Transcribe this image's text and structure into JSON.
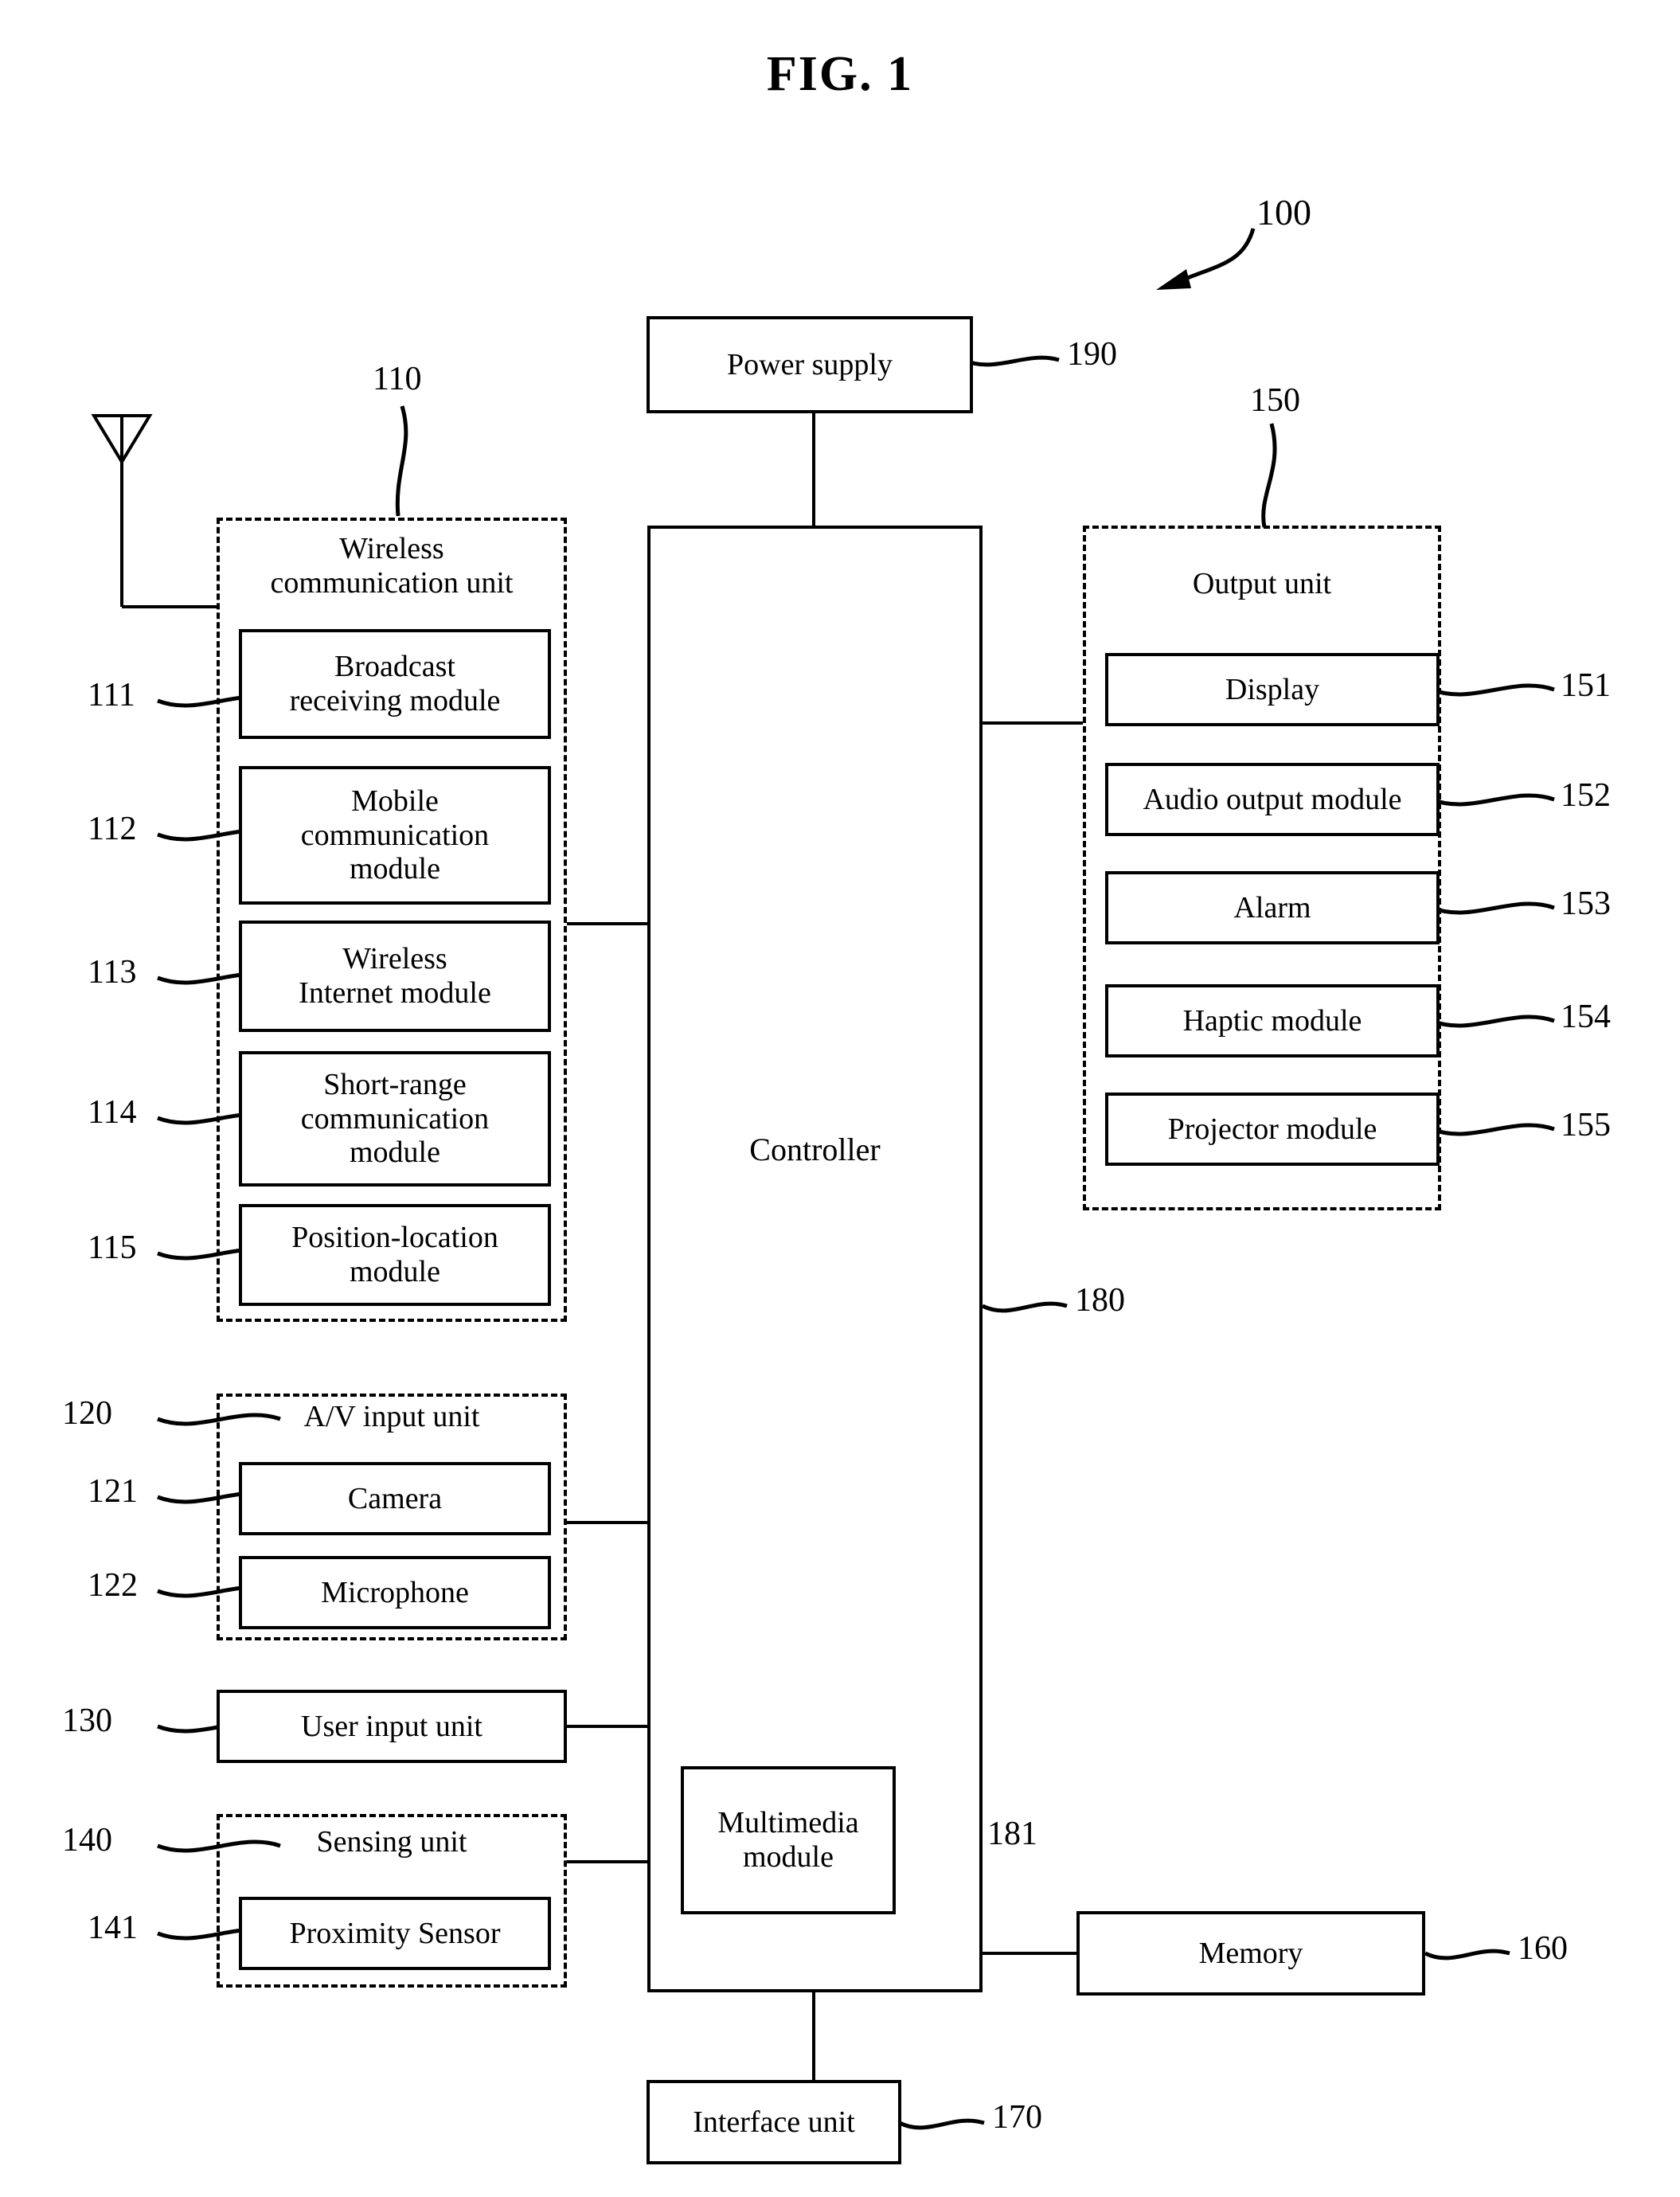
{
  "figure": {
    "title": "FIG. 1",
    "device_ref": "100"
  },
  "power_supply": {
    "label": "Power supply",
    "ref": "190"
  },
  "controller": {
    "label": "Controller",
    "ref": "180"
  },
  "multimedia_module": {
    "label": "Multimedia\nmodule",
    "ref": "181"
  },
  "wireless_unit": {
    "title": "Wireless\ncommunication unit",
    "ref": "110",
    "modules": [
      {
        "label": "Broadcast\nreceiving module",
        "ref": "111"
      },
      {
        "label": "Mobile\ncommunication\nmodule",
        "ref": "112"
      },
      {
        "label": "Wireless\nInternet module",
        "ref": "113"
      },
      {
        "label": "Short-range\ncommunication\nmodule",
        "ref": "114"
      },
      {
        "label": "Position-location\nmodule",
        "ref": "115"
      }
    ]
  },
  "av_input_unit": {
    "title": "A/V input unit",
    "ref": "120",
    "modules": [
      {
        "label": "Camera",
        "ref": "121"
      },
      {
        "label": "Microphone",
        "ref": "122"
      }
    ]
  },
  "user_input_unit": {
    "label": "User input unit",
    "ref": "130"
  },
  "sensing_unit": {
    "title": "Sensing unit",
    "ref": "140",
    "modules": [
      {
        "label": "Proximity Sensor",
        "ref": "141"
      }
    ]
  },
  "output_unit": {
    "title": "Output unit",
    "ref": "150",
    "modules": [
      {
        "label": "Display",
        "ref": "151"
      },
      {
        "label": "Audio output module",
        "ref": "152"
      },
      {
        "label": "Alarm",
        "ref": "153"
      },
      {
        "label": "Haptic module",
        "ref": "154"
      },
      {
        "label": "Projector module",
        "ref": "155"
      }
    ]
  },
  "memory": {
    "label": "Memory",
    "ref": "160"
  },
  "interface_unit": {
    "label": "Interface unit",
    "ref": "170"
  },
  "antenna": {
    "name": "antenna-symbol"
  }
}
